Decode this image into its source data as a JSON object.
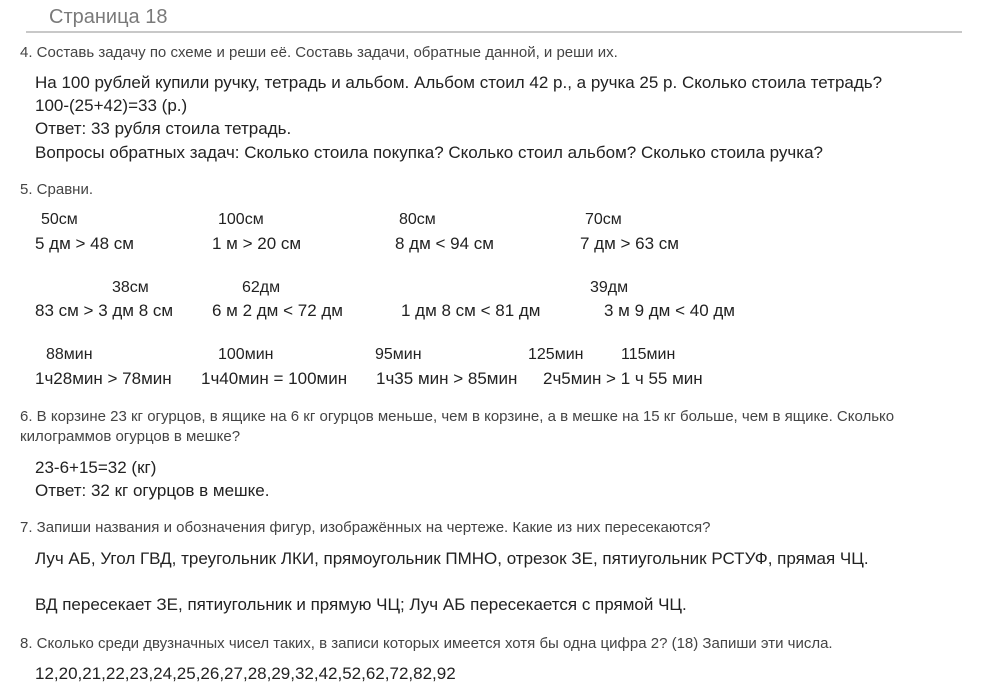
{
  "page": {
    "title": "Страница 18"
  },
  "task4": {
    "question": "4. Составь задачу по схеме и реши её.  Составь задачи, обратные данной, и реши их.",
    "lines": [
      "На 100 рублей купили ручку, тетрадь и альбом. Альбом стоил 42 р., а ручка 25 р. Сколько стоила тетрадь?",
      "100-(25+42)=33 (р.)",
      "Ответ: 33 рубля стоила тетрадь.",
      "Вопросы обратных задач: Сколько стоила покупка? Сколько стоил альбом? Сколько стоила ручка?"
    ]
  },
  "task5": {
    "question": "5. Сравни.",
    "rows": [
      {
        "units": [
          "50см",
          "100см",
          "80см",
          "70см"
        ],
        "comparisons": [
          "5 дм > 48 см",
          "1 м > 20 см",
          "8 дм < 94 см",
          "7 дм > 63 см"
        ]
      },
      {
        "units": [
          "38см",
          "62дм",
          "39дм"
        ],
        "comparisons": [
          "83 см > 3 дм 8 см",
          "6 м 2 дм < 72 дм",
          "1 дм 8 см < 81 дм",
          "3 м 9 дм < 40 дм"
        ]
      },
      {
        "units": [
          "88мин",
          "100мин",
          "95мин",
          "125мин",
          "115мин"
        ],
        "comparisons": [
          "1ч28мин > 78мин",
          "1ч40мин = 100мин",
          "1ч35 мин > 85мин",
          "2ч5мин > 1 ч 55 мин"
        ]
      }
    ]
  },
  "task6": {
    "question_lines": [
      "6. В корзине 23 кг огурцов, в ящике на 6 кг огурцов меньше, чем в корзине, а в мешке на 15 кг больше, чем в ящике. Сколько",
      "килограммов огурцов в мешке?"
    ],
    "lines": [
      "23-6+15=32 (кг)",
      "Ответ: 32 кг огурцов в мешке."
    ]
  },
  "task7": {
    "question": "7. Запиши названия и обозначения фигур, изображённых на чертеже. Какие из них пересекаются?",
    "lines": [
      "Луч АБ, Угол ГВД, треугольник ЛКИ, прямоугольник ПМНО, отрезок ЗЕ, пятиугольник РСТУФ, прямая ЧЦ.",
      "ВД пересекает ЗЕ, пятиугольник и прямую ЧЦ; Луч АБ пересекается с прямой ЧЦ."
    ]
  },
  "task8": {
    "question": "8. Сколько среди двузначных чисел таких, в записи которых имеется хотя бы одна цифра 2? (18) Запиши эти числа.",
    "answer": "12,20,21,22,23,24,25,26,27,28,29,32,42,52,62,72,82,92"
  }
}
